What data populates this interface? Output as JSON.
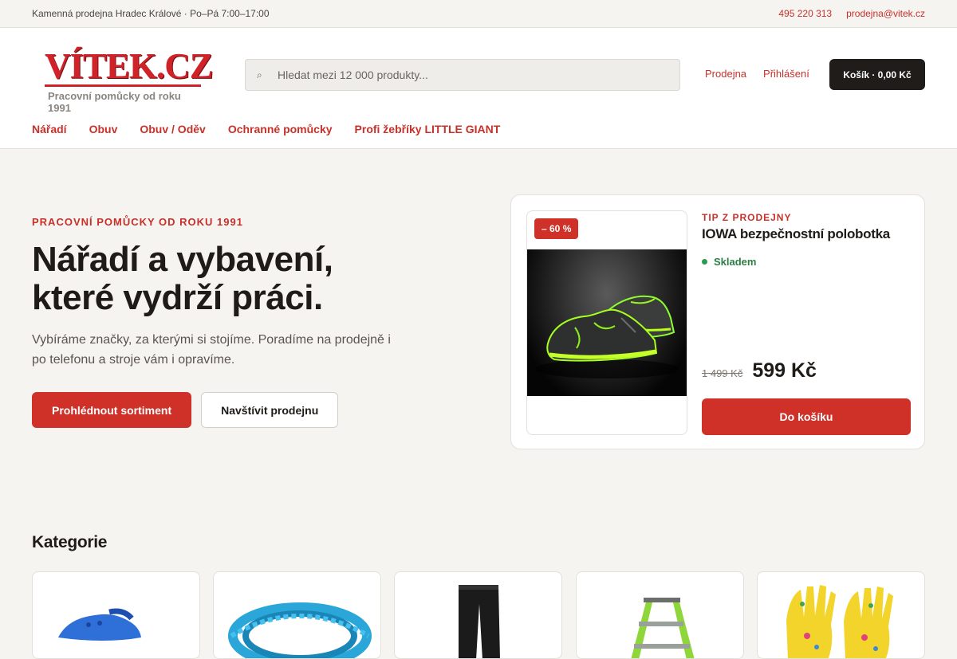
{
  "topbar": {
    "store_info": "Kamenná prodejna Hradec Králové · Po–Pá 7:00–17:00",
    "phone": "495 220 313",
    "email": "prodejna@vitek.cz"
  },
  "header": {
    "logo_text": "VÍTEK.CZ",
    "logo_tagline": "Pracovní pomůcky od roku 1991",
    "search_placeholder": "Hledat mezi 12 000 produkty...",
    "links": [
      "Prodejna",
      "Přihlášení"
    ],
    "cart_label": "Košík · 0,00 Kč"
  },
  "nav": {
    "items": [
      "Nářadí",
      "Obuv",
      "Obuv / Oděv",
      "Ochranné pomůcky",
      "Profi žebříky LITTLE GIANT"
    ]
  },
  "hero": {
    "eyebrow": "PRACOVNÍ POMŮCKY OD ROKU 1991",
    "title": "Nářadí a vybavení, které vydrží práci.",
    "text": "Vybíráme značky, za kterými si stojíme. Poradíme na prodejně i po telefonu a stroje vám i opravíme.",
    "primary_button": "Prohlédnout sortiment",
    "secondary_button": "Navštívit prodejnu"
  },
  "tip": {
    "badge": "– 60 %",
    "eyebrow": "TIP Z PRODEJNY",
    "name": "IOWA bezpečnostní polobotka",
    "stock": "Skladem",
    "old_price": "1 499 Kč",
    "price": "599 Kč",
    "button": "Do košíku"
  },
  "categories": {
    "title": "Kategorie"
  },
  "colors": {
    "accent": "#cf3028",
    "dark": "#1f1c1a",
    "background": "#f6f4f1",
    "in_stock": "#2d7d46"
  }
}
